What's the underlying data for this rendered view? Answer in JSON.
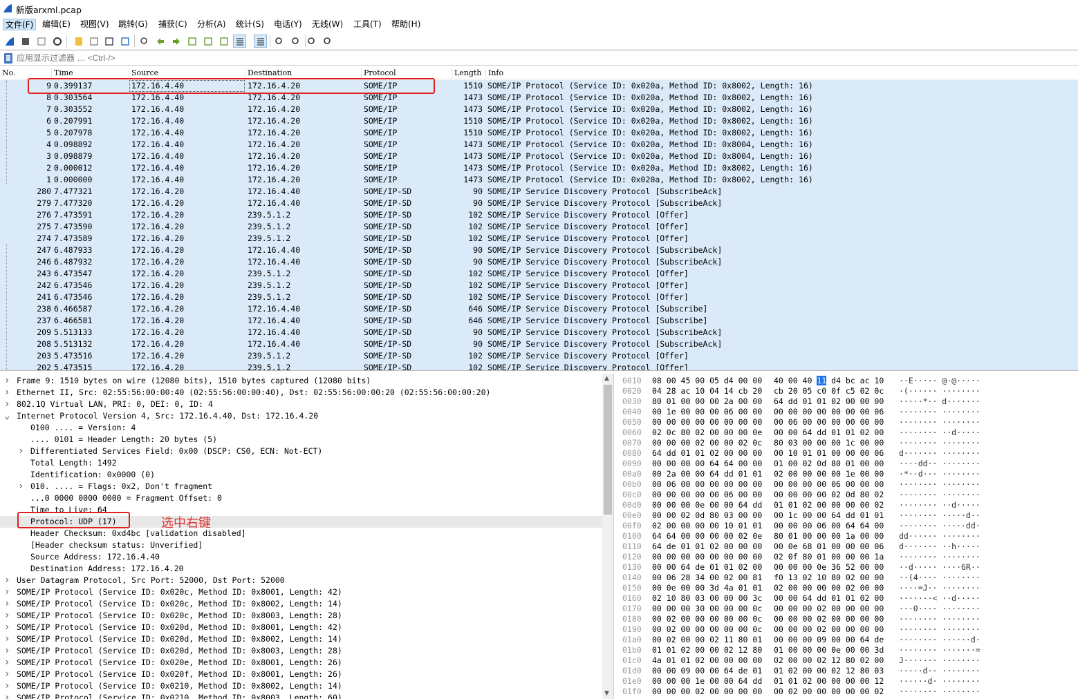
{
  "window": {
    "title": "新版arxml.pcap"
  },
  "menu": [
    "文件(F)",
    "编辑(E)",
    "视图(V)",
    "跳转(G)",
    "捕获(C)",
    "分析(A)",
    "统计(S)",
    "电话(Y)",
    "无线(W)",
    "工具(T)",
    "帮助(H)"
  ],
  "toolbar_icons": [
    "shark-fin-start-icon",
    "stop-capture-icon",
    "restart-capture-icon",
    "capture-options-icon",
    "open-file-icon",
    "save-file-icon",
    "close-file-icon",
    "reload-icon",
    "find-packet-icon",
    "go-back-icon",
    "go-forward-icon",
    "go-to-packet-icon",
    "go-first-icon",
    "go-last-icon",
    "autoscroll-icon",
    "colorize-icon",
    "zoom-in-icon",
    "zoom-out-icon",
    "zoom-normal-icon",
    "resize-columns-icon"
  ],
  "filter": {
    "placeholder": "应用显示过滤器 … <Ctrl-/>"
  },
  "columns": {
    "no": "No.",
    "time": "Time",
    "source": "Source",
    "destination": "Destination",
    "protocol": "Protocol",
    "length": "Length",
    "info": "Info"
  },
  "packets": [
    {
      "no": "9",
      "time": "0.399137",
      "src": "172.16.4.40",
      "dst": "172.16.4.20",
      "proto": "SOME/IP",
      "len": "1510",
      "info": "SOME/IP Protocol (Service ID: 0x020a, Method ID: 0x8002, Length: 16)"
    },
    {
      "no": "8",
      "time": "0.303564",
      "src": "172.16.4.40",
      "dst": "172.16.4.20",
      "proto": "SOME/IP",
      "len": "1473",
      "info": "SOME/IP Protocol (Service ID: 0x020a, Method ID: 0x8002, Length: 16)"
    },
    {
      "no": "7",
      "time": "0.303552",
      "src": "172.16.4.40",
      "dst": "172.16.4.20",
      "proto": "SOME/IP",
      "len": "1473",
      "info": "SOME/IP Protocol (Service ID: 0x020a, Method ID: 0x8002, Length: 16)"
    },
    {
      "no": "6",
      "time": "0.207991",
      "src": "172.16.4.40",
      "dst": "172.16.4.20",
      "proto": "SOME/IP",
      "len": "1510",
      "info": "SOME/IP Protocol (Service ID: 0x020a, Method ID: 0x8002, Length: 16)"
    },
    {
      "no": "5",
      "time": "0.207978",
      "src": "172.16.4.40",
      "dst": "172.16.4.20",
      "proto": "SOME/IP",
      "len": "1510",
      "info": "SOME/IP Protocol (Service ID: 0x020a, Method ID: 0x8002, Length: 16)"
    },
    {
      "no": "4",
      "time": "0.098892",
      "src": "172.16.4.40",
      "dst": "172.16.4.20",
      "proto": "SOME/IP",
      "len": "1473",
      "info": "SOME/IP Protocol (Service ID: 0x020a, Method ID: 0x8004, Length: 16)"
    },
    {
      "no": "3",
      "time": "0.098879",
      "src": "172.16.4.40",
      "dst": "172.16.4.20",
      "proto": "SOME/IP",
      "len": "1473",
      "info": "SOME/IP Protocol (Service ID: 0x020a, Method ID: 0x8004, Length: 16)"
    },
    {
      "no": "2",
      "time": "0.000012",
      "src": "172.16.4.40",
      "dst": "172.16.4.20",
      "proto": "SOME/IP",
      "len": "1473",
      "info": "SOME/IP Protocol (Service ID: 0x020a, Method ID: 0x8002, Length: 16)"
    },
    {
      "no": "1",
      "time": "0.000000",
      "src": "172.16.4.40",
      "dst": "172.16.4.20",
      "proto": "SOME/IP",
      "len": "1473",
      "info": "SOME/IP Protocol (Service ID: 0x020a, Method ID: 0x8002, Length: 16)"
    },
    {
      "no": "280",
      "time": "7.477321",
      "src": "172.16.4.20",
      "dst": "172.16.4.40",
      "proto": "SOME/IP-SD",
      "len": "90",
      "info": "SOME/IP Service Discovery Protocol [SubscribeAck]"
    },
    {
      "no": "279",
      "time": "7.477320",
      "src": "172.16.4.20",
      "dst": "172.16.4.40",
      "proto": "SOME/IP-SD",
      "len": "90",
      "info": "SOME/IP Service Discovery Protocol [SubscribeAck]"
    },
    {
      "no": "276",
      "time": "7.473591",
      "src": "172.16.4.20",
      "dst": "239.5.1.2",
      "proto": "SOME/IP-SD",
      "len": "102",
      "info": "SOME/IP Service Discovery Protocol [Offer]"
    },
    {
      "no": "275",
      "time": "7.473590",
      "src": "172.16.4.20",
      "dst": "239.5.1.2",
      "proto": "SOME/IP-SD",
      "len": "102",
      "info": "SOME/IP Service Discovery Protocol [Offer]"
    },
    {
      "no": "274",
      "time": "7.473589",
      "src": "172.16.4.20",
      "dst": "239.5.1.2",
      "proto": "SOME/IP-SD",
      "len": "102",
      "info": "SOME/IP Service Discovery Protocol [Offer]"
    },
    {
      "no": "247",
      "time": "6.487933",
      "src": "172.16.4.20",
      "dst": "172.16.4.40",
      "proto": "SOME/IP-SD",
      "len": "90",
      "info": "SOME/IP Service Discovery Protocol [SubscribeAck]"
    },
    {
      "no": "246",
      "time": "6.487932",
      "src": "172.16.4.20",
      "dst": "172.16.4.40",
      "proto": "SOME/IP-SD",
      "len": "90",
      "info": "SOME/IP Service Discovery Protocol [SubscribeAck]"
    },
    {
      "no": "243",
      "time": "6.473547",
      "src": "172.16.4.20",
      "dst": "239.5.1.2",
      "proto": "SOME/IP-SD",
      "len": "102",
      "info": "SOME/IP Service Discovery Protocol [Offer]"
    },
    {
      "no": "242",
      "time": "6.473546",
      "src": "172.16.4.20",
      "dst": "239.5.1.2",
      "proto": "SOME/IP-SD",
      "len": "102",
      "info": "SOME/IP Service Discovery Protocol [Offer]"
    },
    {
      "no": "241",
      "time": "6.473546",
      "src": "172.16.4.20",
      "dst": "239.5.1.2",
      "proto": "SOME/IP-SD",
      "len": "102",
      "info": "SOME/IP Service Discovery Protocol [Offer]"
    },
    {
      "no": "238",
      "time": "6.466587",
      "src": "172.16.4.20",
      "dst": "172.16.4.40",
      "proto": "SOME/IP-SD",
      "len": "646",
      "info": "SOME/IP Service Discovery Protocol [Subscribe]"
    },
    {
      "no": "237",
      "time": "6.466581",
      "src": "172.16.4.20",
      "dst": "172.16.4.40",
      "proto": "SOME/IP-SD",
      "len": "646",
      "info": "SOME/IP Service Discovery Protocol [Subscribe]"
    },
    {
      "no": "209",
      "time": "5.513133",
      "src": "172.16.4.20",
      "dst": "172.16.4.40",
      "proto": "SOME/IP-SD",
      "len": "90",
      "info": "SOME/IP Service Discovery Protocol [SubscribeAck]"
    },
    {
      "no": "208",
      "time": "5.513132",
      "src": "172.16.4.20",
      "dst": "172.16.4.40",
      "proto": "SOME/IP-SD",
      "len": "90",
      "info": "SOME/IP Service Discovery Protocol [SubscribeAck]"
    },
    {
      "no": "203",
      "time": "5.473516",
      "src": "172.16.4.20",
      "dst": "239.5.1.2",
      "proto": "SOME/IP-SD",
      "len": "102",
      "info": "SOME/IP Service Discovery Protocol [Offer]"
    },
    {
      "no": "202",
      "time": "5.473515",
      "src": "172.16.4.20",
      "dst": "239.5.1.2",
      "proto": "SOME/IP-SD",
      "len": "102",
      "info": "SOME/IP Service Discovery Protocol [Offer]"
    }
  ],
  "details": [
    {
      "arrow": ">",
      "indent": 0,
      "text": "Frame 9: 1510 bytes on wire (12080 bits), 1510 bytes captured (12080 bits)"
    },
    {
      "arrow": ">",
      "indent": 0,
      "text": "Ethernet II, Src: 02:55:56:00:00:40 (02:55:56:00:00:40), Dst: 02:55:56:00:00:20 (02:55:56:00:00:20)"
    },
    {
      "arrow": ">",
      "indent": 0,
      "text": "802.1Q Virtual LAN, PRI: 0, DEI: 0, ID: 4"
    },
    {
      "arrow": "v",
      "indent": 0,
      "text": "Internet Protocol Version 4, Src: 172.16.4.40, Dst: 172.16.4.20"
    },
    {
      "arrow": "",
      "indent": 1,
      "text": "0100 .... = Version: 4"
    },
    {
      "arrow": "",
      "indent": 1,
      "text": ".... 0101 = Header Length: 20 bytes (5)"
    },
    {
      "arrow": ">",
      "indent": 1,
      "text": "Differentiated Services Field: 0x00 (DSCP: CS0, ECN: Not-ECT)"
    },
    {
      "arrow": "",
      "indent": 1,
      "text": "Total Length: 1492"
    },
    {
      "arrow": "",
      "indent": 1,
      "text": "Identification: 0x0000 (0)"
    },
    {
      "arrow": ">",
      "indent": 1,
      "text": "010. .... = Flags: 0x2, Don't fragment"
    },
    {
      "arrow": "",
      "indent": 1,
      "text": "...0 0000 0000 0000 = Fragment Offset: 0"
    },
    {
      "arrow": "",
      "indent": 1,
      "text": "Time to Live: 64"
    },
    {
      "arrow": "",
      "indent": 1,
      "text": "Protocol: UDP (17)",
      "hl": true
    },
    {
      "arrow": "",
      "indent": 1,
      "text": "Header Checksum: 0xd4bc [validation disabled]"
    },
    {
      "arrow": "",
      "indent": 1,
      "text": "[Header checksum status: Unverified]"
    },
    {
      "arrow": "",
      "indent": 1,
      "text": "Source Address: 172.16.4.40"
    },
    {
      "arrow": "",
      "indent": 1,
      "text": "Destination Address: 172.16.4.20"
    },
    {
      "arrow": ">",
      "indent": 0,
      "text": "User Datagram Protocol, Src Port: 52000, Dst Port: 52000"
    },
    {
      "arrow": ">",
      "indent": 0,
      "text": "SOME/IP Protocol (Service ID: 0x020c, Method ID: 0x8001, Length: 42)"
    },
    {
      "arrow": ">",
      "indent": 0,
      "text": "SOME/IP Protocol (Service ID: 0x020c, Method ID: 0x8002, Length: 14)"
    },
    {
      "arrow": ">",
      "indent": 0,
      "text": "SOME/IP Protocol (Service ID: 0x020c, Method ID: 0x8003, Length: 28)"
    },
    {
      "arrow": ">",
      "indent": 0,
      "text": "SOME/IP Protocol (Service ID: 0x020d, Method ID: 0x8001, Length: 42)"
    },
    {
      "arrow": ">",
      "indent": 0,
      "text": "SOME/IP Protocol (Service ID: 0x020d, Method ID: 0x8002, Length: 14)"
    },
    {
      "arrow": ">",
      "indent": 0,
      "text": "SOME/IP Protocol (Service ID: 0x020d, Method ID: 0x8003, Length: 28)"
    },
    {
      "arrow": ">",
      "indent": 0,
      "text": "SOME/IP Protocol (Service ID: 0x020e, Method ID: 0x8001, Length: 26)"
    },
    {
      "arrow": ">",
      "indent": 0,
      "text": "SOME/IP Protocol (Service ID: 0x020f, Method ID: 0x8001, Length: 26)"
    },
    {
      "arrow": ">",
      "indent": 0,
      "text": "SOME/IP Protocol (Service ID: 0x0210, Method ID: 0x8002, Length: 14)"
    },
    {
      "arrow": ">",
      "indent": 0,
      "text": "SOME/IP Protocol (Service ID: 0x0210, Method ID: 0x8003, Length: 60)"
    }
  ],
  "annotation": "选中右键",
  "hex": [
    {
      "off": "0010",
      "b1": "08 00 45 00 05 d4 00 00",
      "b2": "40 00 40",
      "hl": "11",
      "b2r": "d4 bc ac 10",
      "ascii": "··E·····  @·@·····"
    },
    {
      "off": "0020",
      "b1": "04 28 ac 10 04 14 cb 20",
      "b2": "cb 20 05 c0 0f c5 02 0c",
      "ascii": "·(······  ········"
    },
    {
      "off": "0030",
      "b1": "80 01 00 00 00 2a 00 00",
      "b2": "64 dd 01 01 02 00 00 00",
      "ascii": "·····*··  d·······"
    },
    {
      "off": "0040",
      "b1": "00 1e 00 00 00 06 00 00",
      "b2": "00 00 00 00 00 00 00 06",
      "ascii": "········  ········"
    },
    {
      "off": "0050",
      "b1": "00 00 00 00 00 00 00 00",
      "b2": "00 06 00 00 00 00 00 00",
      "ascii": "········  ········"
    },
    {
      "off": "0060",
      "b1": "02 0c 80 02 00 00 00 0e",
      "b2": "00 00 64 dd 01 01 02 00",
      "ascii": "········  ··d·····"
    },
    {
      "off": "0070",
      "b1": "00 00 00 02 00 00 02 0c",
      "b2": "80 03 00 00 00 1c 00 00",
      "ascii": "········  ········"
    },
    {
      "off": "0080",
      "b1": "64 dd 01 01 02 00 00 00",
      "b2": "00 10 01 01 00 00 00 06",
      "ascii": "d·······  ········"
    },
    {
      "off": "0090",
      "b1": "00 00 00 00 64 64 00 00",
      "b2": "01 00 02 0d 80 01 00 00",
      "ascii": "····dd··  ········"
    },
    {
      "off": "00a0",
      "b1": "00 2a 00 00 64 dd 01 01",
      "b2": "02 00 00 00 00 1e 00 00",
      "ascii": "·*··d···  ········"
    },
    {
      "off": "00b0",
      "b1": "00 06 00 00 00 00 00 00",
      "b2": "00 00 00 00 06 00 00 00",
      "ascii": "········  ········"
    },
    {
      "off": "00c0",
      "b1": "00 00 00 00 00 06 00 00",
      "b2": "00 00 00 00 02 0d 80 02",
      "ascii": "········  ········"
    },
    {
      "off": "00d0",
      "b1": "00 00 00 0e 00 00 64 dd",
      "b2": "01 01 02 00 00 00 00 02",
      "ascii": "········  ··d·····"
    },
    {
      "off": "00e0",
      "b1": "00 00 02 0d 80 03 00 00",
      "b2": "00 1c 00 00 64 dd 01 01",
      "ascii": "········  ·····d··"
    },
    {
      "off": "00f0",
      "b1": "02 00 00 00 00 10 01 01",
      "b2": "00 00 00 06 00 64 64 00",
      "ascii": "········  ·····dd·"
    },
    {
      "off": "0100",
      "b1": "64 64 00 00 00 00 02 0e",
      "b2": "80 01 00 00 00 1a 00 00",
      "ascii": "dd······  ········"
    },
    {
      "off": "0110",
      "b1": "64 de 01 01 02 00 00 00",
      "b2": "00 0e 68 01 00 00 00 06",
      "ascii": "d·······  ··h·····"
    },
    {
      "off": "0120",
      "b1": "00 00 00 00 00 00 00 00",
      "b2": "02 0f 80 01 00 00 00 1a",
      "ascii": "········  ········"
    },
    {
      "off": "0130",
      "b1": "00 00 64 de 01 01 02 00",
      "b2": "00 00 00 0e 36 52 00 00",
      "ascii": "··d·····  ····6R··"
    },
    {
      "off": "0140",
      "b1": "00 06 28 34 00 02 00 81",
      "b2": "f0 13 02 10 80 02 00 00",
      "ascii": "··(4····  ········"
    },
    {
      "off": "0150",
      "b1": "00 0e 00 00 3d 4a 01 01",
      "b2": "02 00 00 00 00 02 00 00",
      "ascii": "····=J··  ········"
    },
    {
      "off": "0160",
      "b1": "02 10 80 03 00 00 00 3c",
      "b2": "00 00 64 dd 01 01 02 00",
      "ascii": "·······<  ··d·····"
    },
    {
      "off": "0170",
      "b1": "00 00 00 30 00 00 00 0c",
      "b2": "00 00 00 02 00 00 00 00",
      "ascii": "···0····  ········"
    },
    {
      "off": "0180",
      "b1": "00 02 00 00 00 00 00 0c",
      "b2": "00 00 00 02 00 00 00 00",
      "ascii": "········  ········"
    },
    {
      "off": "0190",
      "b1": "00 02 00 00 00 00 00 0c",
      "b2": "00 00 00 02 00 00 00 00",
      "ascii": "········  ········"
    },
    {
      "off": "01a0",
      "b1": "00 02 00 00 02 11 80 01",
      "b2": "00 00 00 09 00 00 64 de",
      "ascii": "········  ······d·"
    },
    {
      "off": "01b0",
      "b1": "01 01 02 00 00 02 12 80",
      "b2": "01 00 00 00 0e 00 00 3d",
      "ascii": "········  ·······="
    },
    {
      "off": "01c0",
      "b1": "4a 01 01 02 00 00 00 00",
      "b2": "02 00 00 02 12 80 02 00",
      "ascii": "J·······  ········"
    },
    {
      "off": "01d0",
      "b1": "00 00 09 00 00 64 de 01",
      "b2": "01 02 00 00 02 12 80 03",
      "ascii": "·····d··  ········"
    },
    {
      "off": "01e0",
      "b1": "00 00 00 1e 00 00 64 dd",
      "b2": "01 01 02 00 00 00 00 12",
      "ascii": "······d·  ········"
    },
    {
      "off": "01f0",
      "b1": "00 00 00 02 00 00 00 00",
      "b2": "00 02 00 00 00 00 00 02",
      "ascii": "········  ········"
    }
  ],
  "colors": {
    "row_bg": "#dbeaf9",
    "highlight_red": "#e02020",
    "hex_selected": "#1a73e8"
  }
}
